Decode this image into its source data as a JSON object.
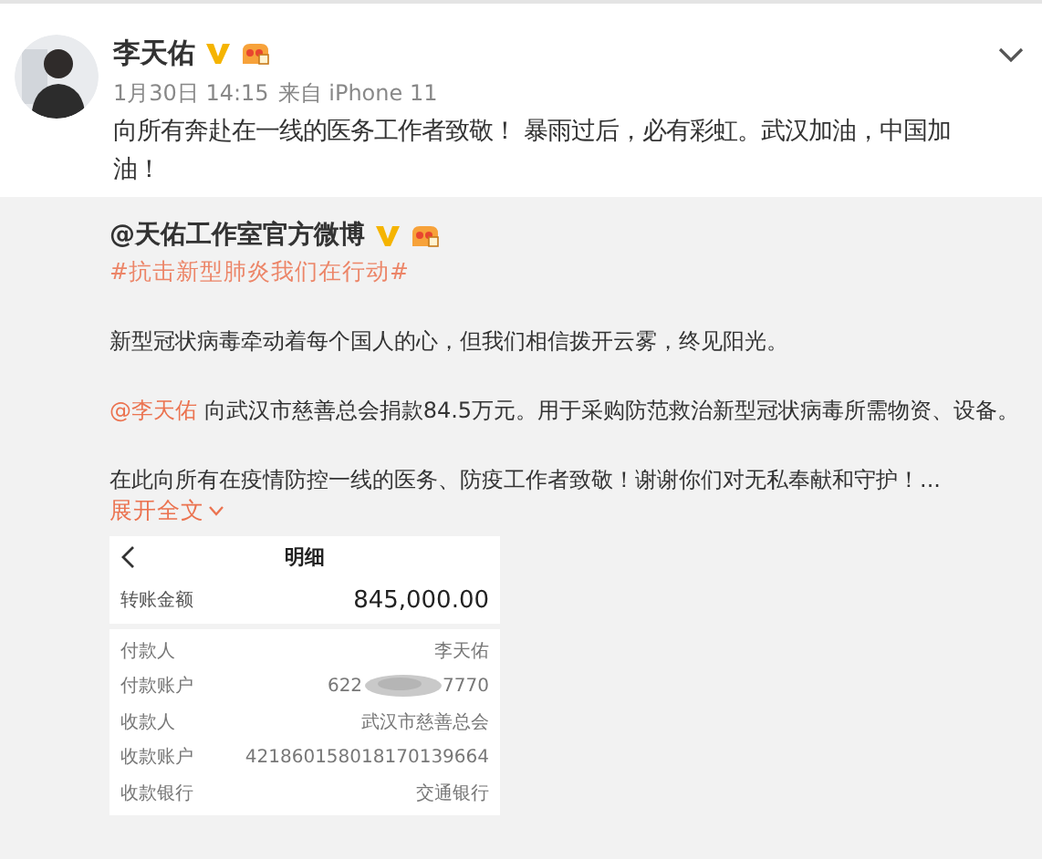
{
  "post": {
    "author": "李天佑",
    "verified": true,
    "time": "1月30日 14:15",
    "source": "来自 iPhone 11",
    "text": "向所有奔赴在一线的医务工作者致敬！ 暴雨过后，必有彩虹。武汉加油，中国加油！"
  },
  "repost": {
    "author": "@天佑工作室官方微博",
    "verified": true,
    "hashtag": "#抗击新型肺炎我们在行动#",
    "paragraphs": [
      {
        "text": "新型冠状病毒牵动着每个国人的心，但我们相信拨开云雾，终见阳光。"
      },
      {
        "mention": "@李天佑",
        "text": " 向武汉市慈善总会捐款84.5万元。用于采购防范救治新型冠状病毒所需物资、设备。"
      },
      {
        "text": "在此向所有在疫情防控一线的医务、防疫工作者致敬！谢谢你们对无私奉献和守护！..."
      }
    ],
    "expand": "展开全文",
    "receipt": {
      "title": "明细",
      "amount_label": "转账金额",
      "amount": "845,000.00",
      "rows": [
        {
          "label": "付款人",
          "value": "李天佑",
          "masked": false
        },
        {
          "label": "付款账户",
          "value": "622",
          "value_end": "7770",
          "masked": true
        },
        {
          "label": "收款人",
          "value": "武汉市慈善总会",
          "masked": false
        },
        {
          "label": "收款账户",
          "value": "421860158018170139664",
          "masked": false
        },
        {
          "label": "收款银行",
          "value": "交通银行",
          "masked": false
        }
      ]
    }
  }
}
